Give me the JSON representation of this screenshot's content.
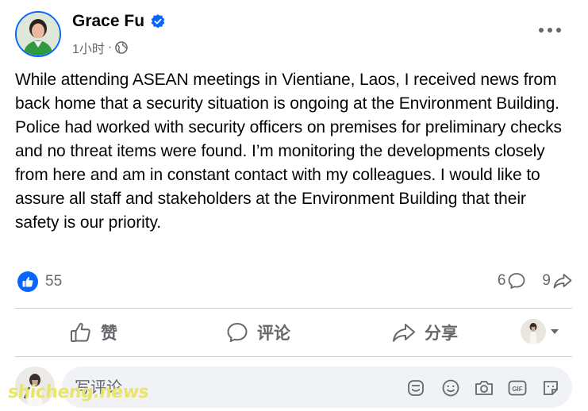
{
  "author": {
    "name": "Grace Fu",
    "verified": true
  },
  "post_meta": {
    "time": "1小时",
    "separator": "·",
    "audience_icon": "globe-icon"
  },
  "post": {
    "text": "While attending ASEAN meetings in Vientiane, Laos, I received news from back home that a security situation is ongoing at the Environment Building. Police had worked with security officers on premises for preliminary checks and no threat items were found. I’m monitoring the developments closely from here and am in constant contact with my colleagues. I would like to assure all staff and stakeholders at the Environment Building that their safety is our priority."
  },
  "stats": {
    "reactions": "55",
    "comments": "6",
    "shares": "9"
  },
  "actions": {
    "like": "赞",
    "comment": "评论",
    "share": "分享"
  },
  "comment_box": {
    "placeholder": "写评论"
  },
  "watermark": "shicheng.news",
  "colors": {
    "accent": "#0866ff",
    "secondary_text": "#65676b",
    "divider": "#ced0d4",
    "input_bg": "#f0f2f5"
  }
}
